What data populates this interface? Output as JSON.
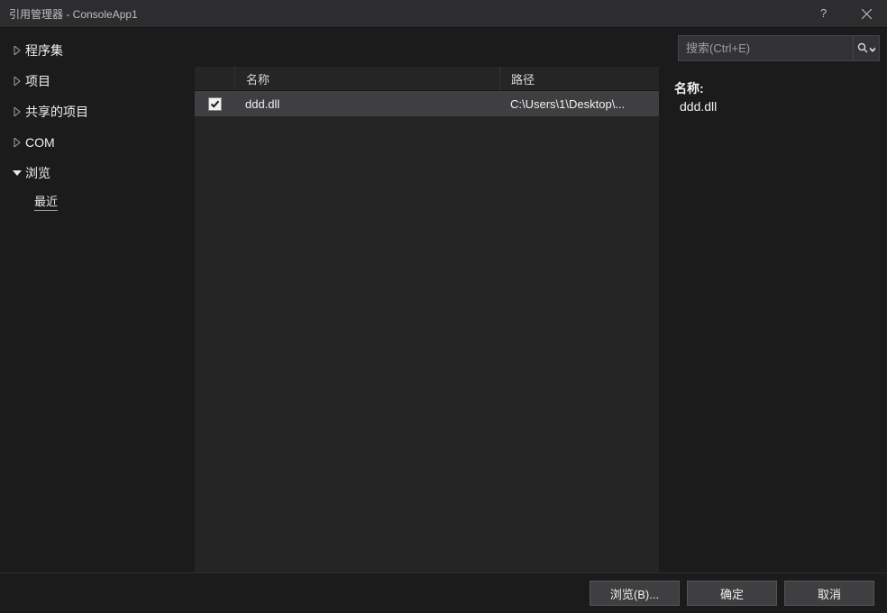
{
  "window": {
    "title": "引用管理器 - ConsoleApp1"
  },
  "sidebar": {
    "items": [
      {
        "label": "程序集",
        "expanded": false
      },
      {
        "label": "项目",
        "expanded": false
      },
      {
        "label": "共享的项目",
        "expanded": false
      },
      {
        "label": "COM",
        "expanded": false
      },
      {
        "label": "浏览",
        "expanded": true,
        "children": [
          {
            "label": "最近"
          }
        ]
      }
    ]
  },
  "search": {
    "placeholder": "搜索(Ctrl+E)",
    "value": ""
  },
  "list": {
    "columns": {
      "name": "名称",
      "path": "路径"
    },
    "rows": [
      {
        "checked": true,
        "name": "ddd.dll",
        "path": "C:\\Users\\1\\Desktop\\..."
      }
    ]
  },
  "detail": {
    "name_label": "名称:",
    "name_value": "ddd.dll"
  },
  "footer": {
    "browse": "浏览(B)...",
    "ok": "确定",
    "cancel": "取消"
  }
}
